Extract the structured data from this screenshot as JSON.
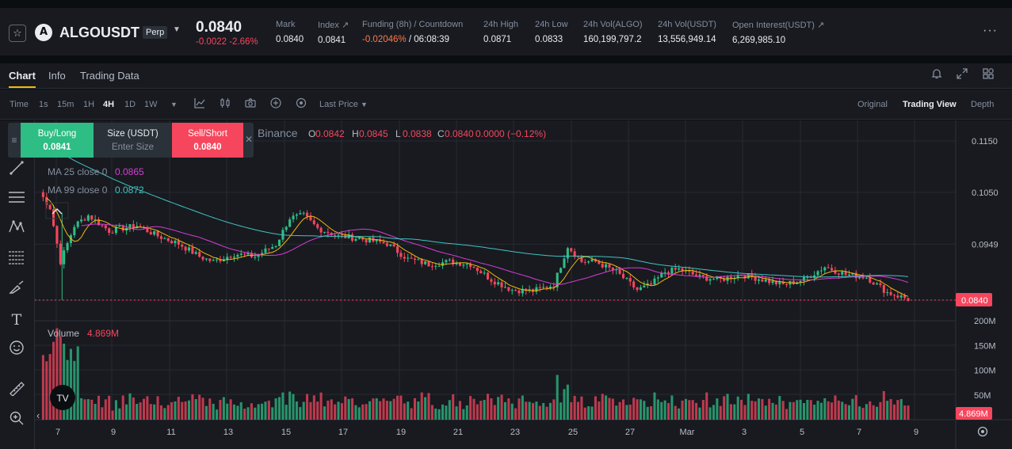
{
  "header": {
    "favorite_icon": "star-icon",
    "symbol": "ALGOUSDT",
    "badge": "Perp",
    "last_price": "0.0840",
    "change": "-0.0022",
    "change_pct": "-2.66%",
    "stats": [
      {
        "label": "Mark",
        "value": "0.0840"
      },
      {
        "label": "Index ↗",
        "value": "0.0841"
      },
      {
        "label": "Funding (8h) / Countdown",
        "value_red": "-0.02046%",
        "value": " / 06:08:39"
      },
      {
        "label": "24h High",
        "value": "0.0871"
      },
      {
        "label": "24h Low",
        "value": "0.0833"
      },
      {
        "label": "24h Vol(ALGO)",
        "value": "160,199,797.2"
      },
      {
        "label": "24h Vol(USDT)",
        "value": "13,556,949.14"
      },
      {
        "label": "Open Interest(USDT) ↗",
        "value": "6,269,985.10"
      }
    ],
    "more": "···"
  },
  "tabs": [
    "Chart",
    "Info",
    "Trading Data"
  ],
  "toolbar": {
    "intervals": [
      "Time",
      "1s",
      "15m",
      "1H",
      "4H",
      "1D",
      "1W"
    ],
    "active_interval": "4H",
    "price_type": "Last Price",
    "views": [
      "Original",
      "Trading View",
      "Depth"
    ],
    "active_view": "Trading View"
  },
  "trade_panel": {
    "buy_label": "Buy/Long",
    "buy_price": "0.0841",
    "size_label": "Size (USDT)",
    "size_placeholder": "Enter Size",
    "sell_label": "Sell/Short",
    "sell_price": "0.0840"
  },
  "legend": {
    "source": "Binance",
    "o_label": "O",
    "o": "0.0842",
    "h_label": "H",
    "h": "0.0845",
    "l_label": "L",
    "l": "0.0838",
    "c_label": "C",
    "c": "0.0840",
    "change": "0.0000 (−0.12%)",
    "ma25_label": "MA 25 close 0",
    "ma25": "0.0865",
    "ma99_label": "MA 99 close 0",
    "ma99": "0.0872",
    "volume_label": "Volume",
    "volume": "4.869M"
  },
  "colors": {
    "up": "#2ebd85",
    "down": "#f6465d",
    "ma7": "#f0b90b",
    "ma25": "#d63ed6",
    "ma99": "#3fc5c0"
  },
  "chart_data": {
    "type": "candlestick",
    "price_axis": [
      "0.1150",
      "0.1050",
      "0.0949",
      "0.0840"
    ],
    "current_price": "0.0840",
    "volume_axis": [
      "200M",
      "150M",
      "100M",
      "50M"
    ],
    "current_volume": "4.869M",
    "x_ticks": [
      "7",
      "9",
      "11",
      "13",
      "15",
      "17",
      "19",
      "21",
      "23",
      "25",
      "27",
      "Mar",
      "3",
      "5",
      "7",
      "9"
    ],
    "price_range": [
      0.08,
      0.119
    ],
    "volume_range": [
      0,
      200
    ]
  }
}
